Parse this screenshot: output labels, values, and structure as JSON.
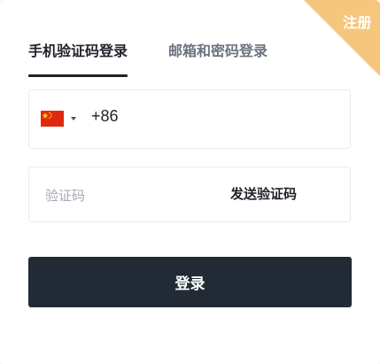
{
  "corner": {
    "register_label": "注册"
  },
  "tabs": [
    {
      "label": "手机验证码登录",
      "active": true
    },
    {
      "label": "邮箱和密码登录",
      "active": false
    }
  ],
  "phone": {
    "country_flag": "china-flag-icon",
    "dial_code": "+86",
    "value": "",
    "placeholder": ""
  },
  "code": {
    "value": "",
    "placeholder": "验证码",
    "send_label": "发送验证码"
  },
  "login": {
    "label": "登录"
  },
  "colors": {
    "accent_dark": "#222a35",
    "ribbon": "#f6c67c",
    "flag_red": "#de2910",
    "flag_yellow": "#ffde00"
  }
}
